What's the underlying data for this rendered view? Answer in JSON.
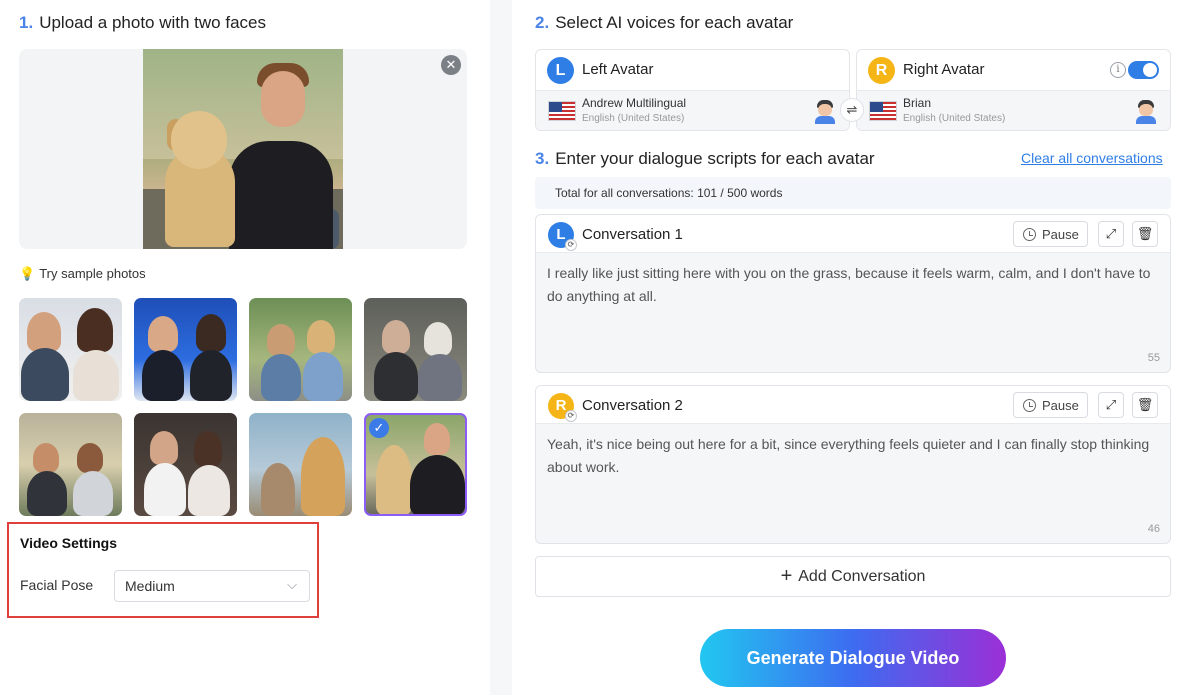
{
  "step1": {
    "num": "1.",
    "title": "Upload a photo with two faces"
  },
  "upload": {
    "close_glyph": "✕"
  },
  "samples": {
    "label": "Try sample photos",
    "bulb_glyph": "💡",
    "items": [
      {
        "name": "couple-news"
      },
      {
        "name": "news-anchors"
      },
      {
        "name": "kids"
      },
      {
        "name": "elderly-couple"
      },
      {
        "name": "camping-couple"
      },
      {
        "name": "formal-couple"
      },
      {
        "name": "cat-and-dog"
      },
      {
        "name": "man-and-dog"
      }
    ],
    "check_glyph": "✓"
  },
  "video_settings": {
    "title": "Video Settings",
    "facial_pose_label": "Facial Pose",
    "facial_pose_value": "Medium",
    "chevron_glyph": "⌵"
  },
  "step2": {
    "num": "2.",
    "title": "Select AI voices for each avatar"
  },
  "avatars": {
    "left": {
      "badge": "L",
      "name": "Left Avatar",
      "voice": "Andrew Multilingual",
      "lang": "English (United States)"
    },
    "right": {
      "badge": "R",
      "name": "Right Avatar",
      "voice": "Brian",
      "lang": "English (United States)"
    },
    "swap_glyph": "⇌",
    "info_glyph": "i"
  },
  "step3": {
    "num": "3.",
    "title": "Enter your dialogue scripts for each avatar"
  },
  "clear_all": "Clear all conversations",
  "total": "Total for all conversations: 101 / 500 words",
  "conversations": [
    {
      "badge": "L",
      "title": "Conversation 1",
      "pause": "Pause",
      "text": "I really like just sitting here with you on the grass, because it feels warm, calm, and I don't have to do anything at all.",
      "count": "55"
    },
    {
      "badge": "R",
      "title": "Conversation 2",
      "pause": "Pause",
      "text": "Yeah, it's nice being out here for a bit, since everything feels quieter and I can finally stop thinking about work.",
      "count": "46"
    }
  ],
  "icons": {
    "expand": "⤢",
    "trash": "🗑",
    "sync": "⟳"
  },
  "add_conversation": {
    "plus": "+",
    "label": "Add Conversation"
  },
  "generate": "Generate Dialogue Video",
  "colors": {
    "accent": "#2f7ee6",
    "highlight_border": "#e0403c",
    "left_badge": "#2f7ee6",
    "right_badge": "#f5b517"
  }
}
